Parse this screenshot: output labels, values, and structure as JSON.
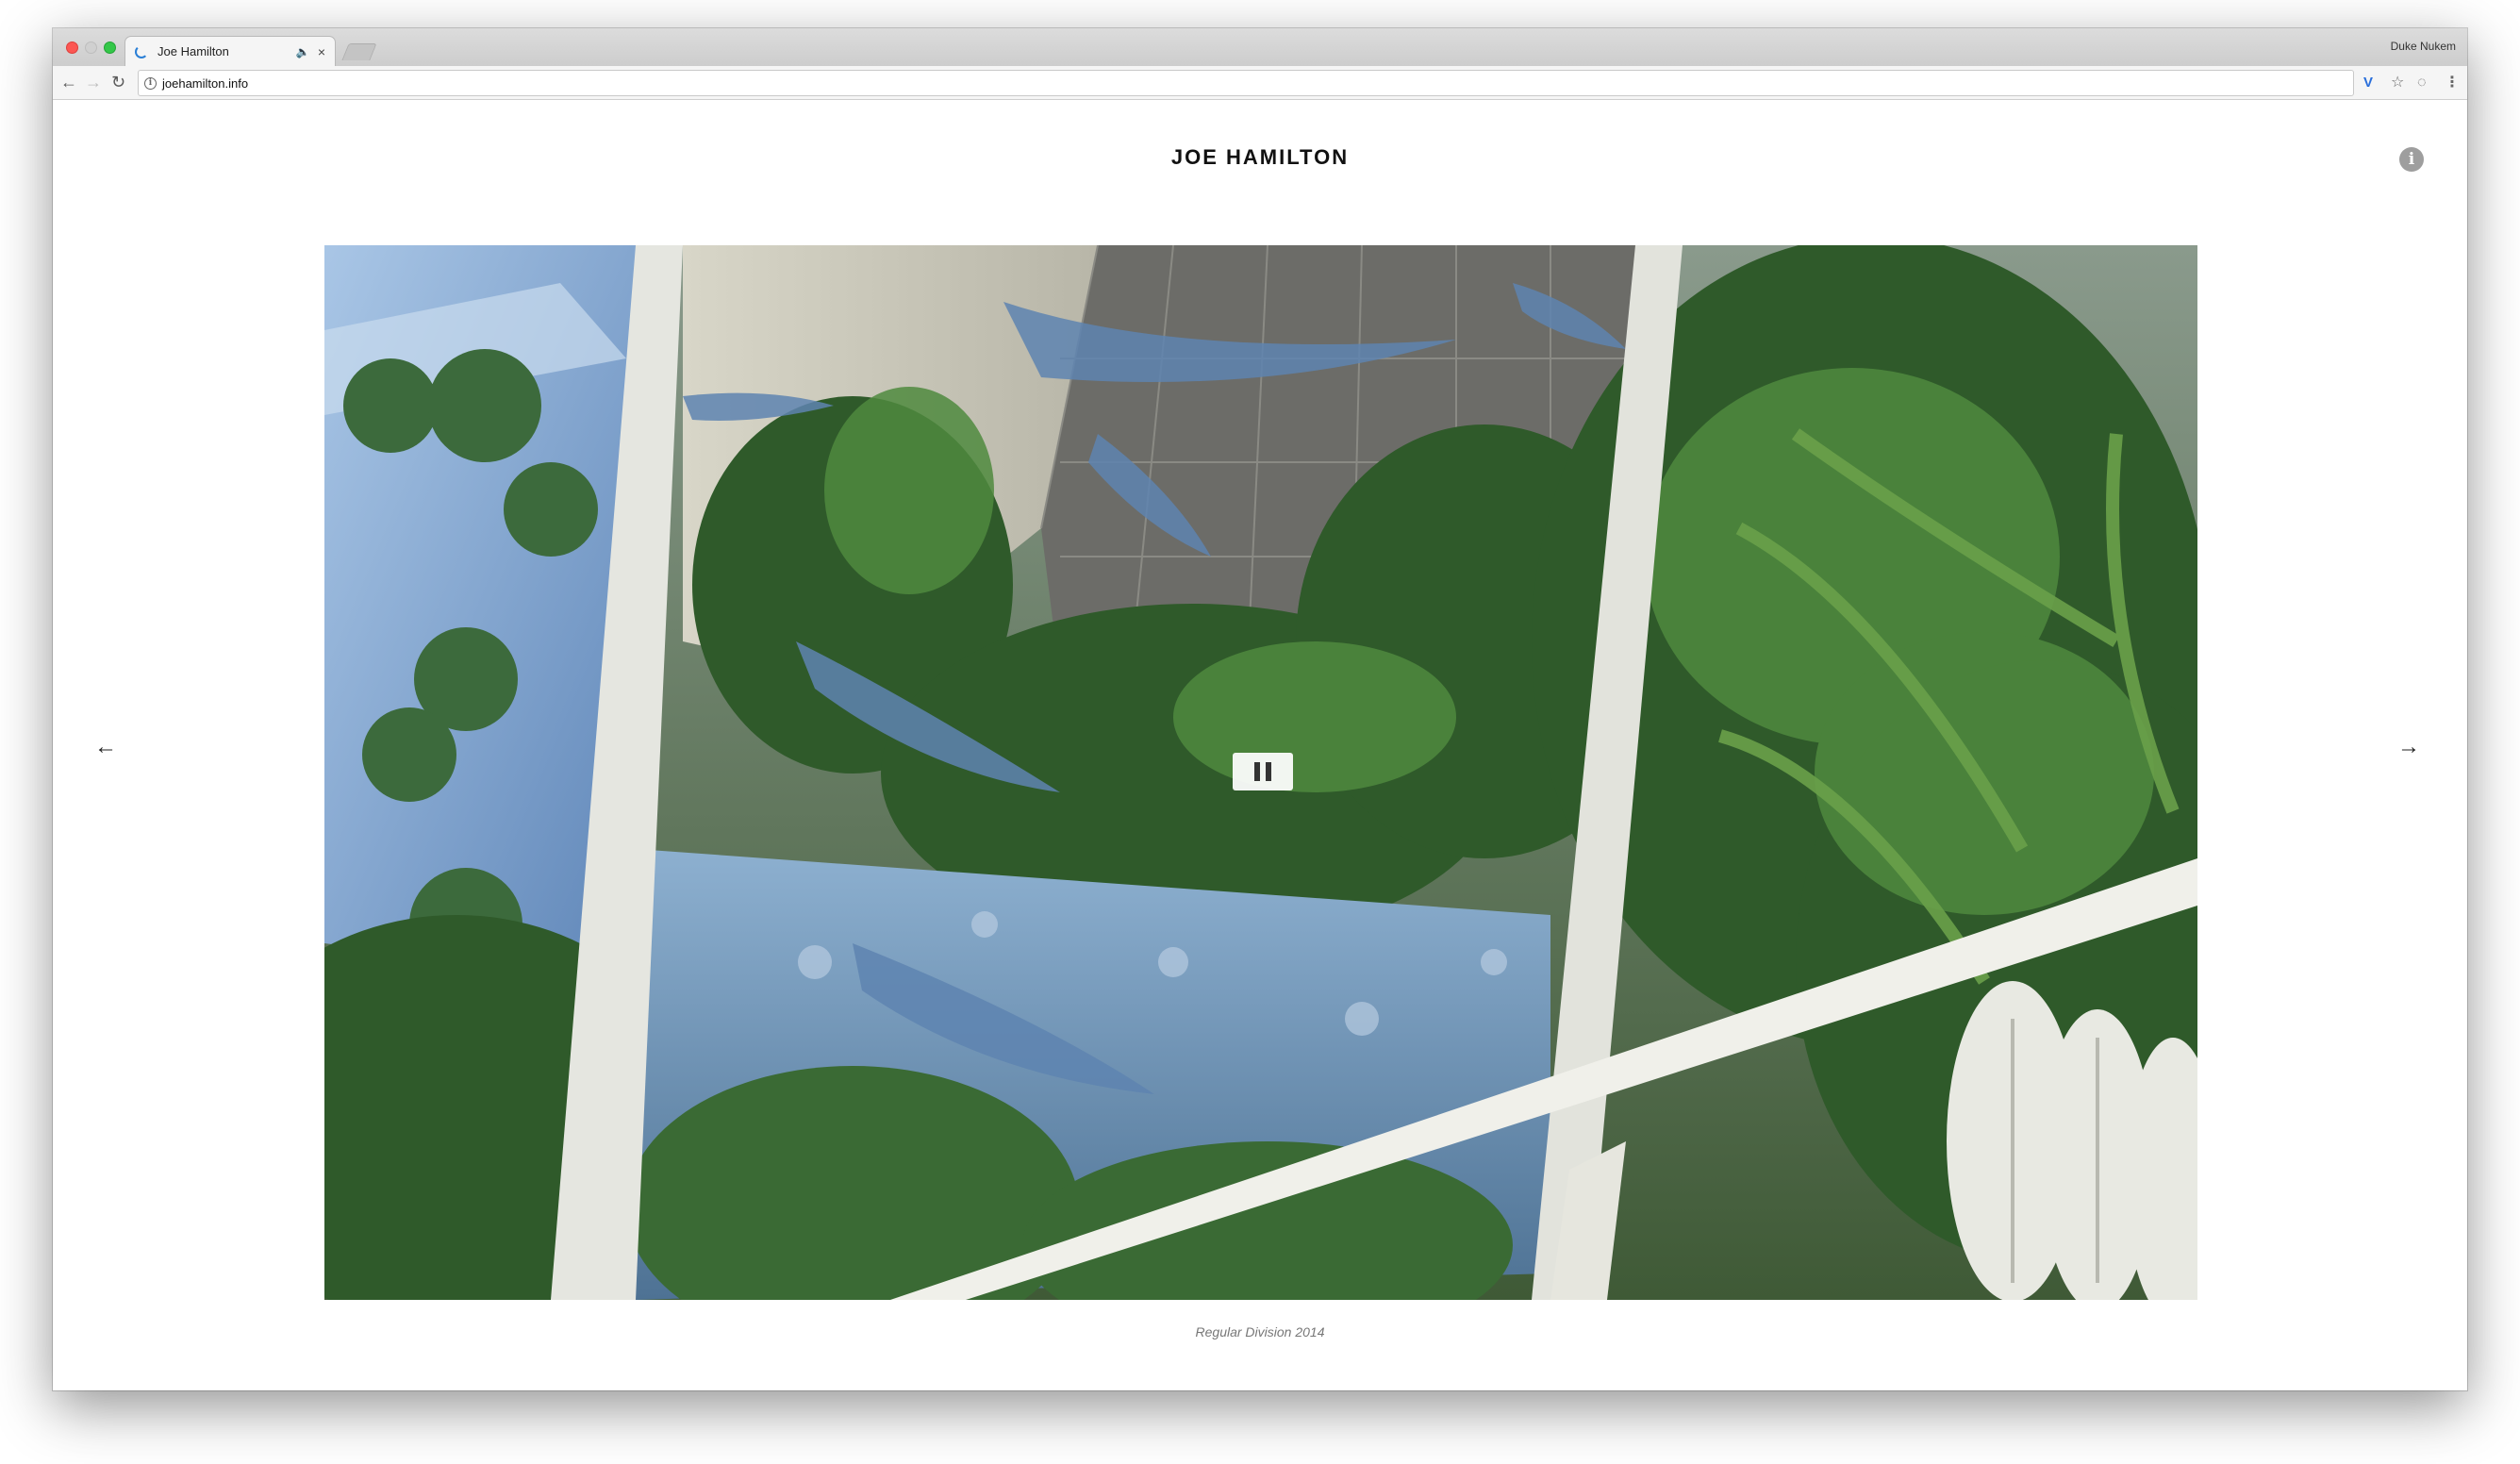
{
  "browser": {
    "tab": {
      "title": "Joe Hamilton",
      "audio_icon": "speaker-icon",
      "close_glyph": "×"
    },
    "profile_name": "Duke Nukem",
    "address_bar": {
      "url": "joehamilton.info",
      "security_icon": "info-circle-icon"
    },
    "toolbar_icons": [
      "back-arrow-icon",
      "forward-arrow-icon",
      "reload-icon",
      "extension-icon",
      "star-icon",
      "shield-icon",
      "menu-icon"
    ]
  },
  "page": {
    "title": "JOE HAMILTON",
    "info_glyph": "i",
    "prev_arrow": "←",
    "next_arrow": "→",
    "media": {
      "state": "playing",
      "control_icon": "pause-icon"
    },
    "caption": "Regular Division 2014"
  },
  "colors": {
    "chrome_tab_bar": "#d4d4d4",
    "accent_blue": "#2a7fd6",
    "info_icon": "#9e9e9e",
    "caption_text": "#777777"
  }
}
